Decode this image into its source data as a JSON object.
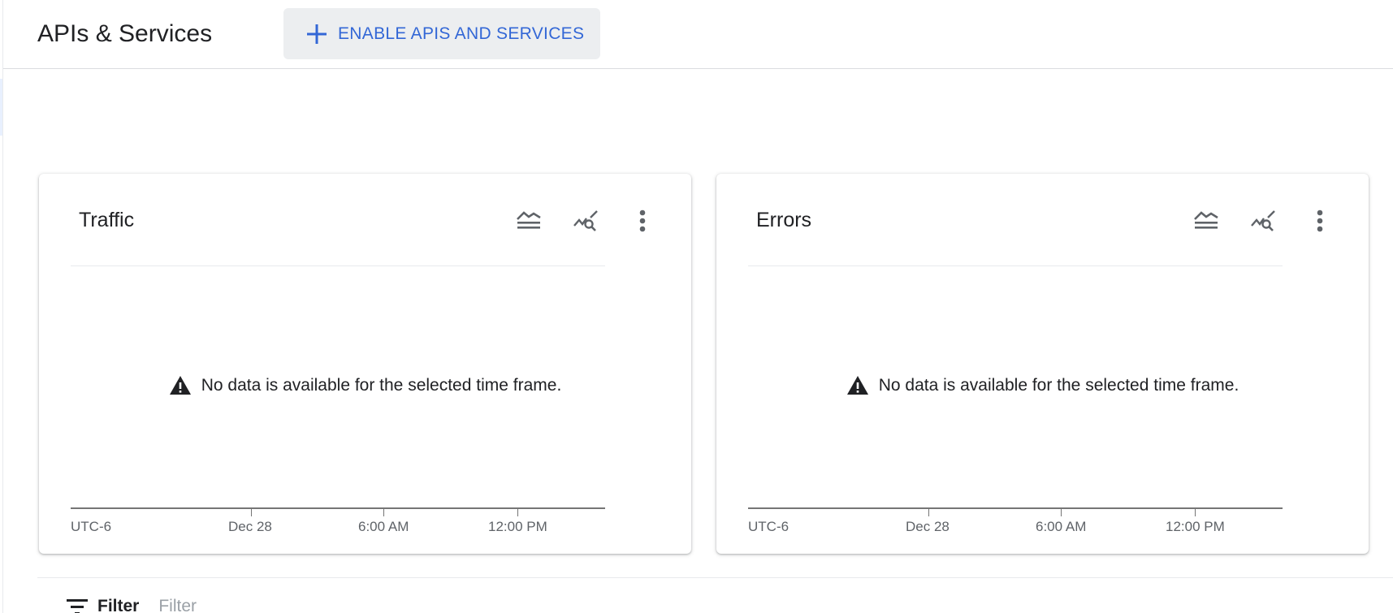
{
  "header": {
    "title": "APIs & Services",
    "enable_button_label": "ENABLE APIS AND SERVICES",
    "enable_button_icon": "plus-icon"
  },
  "cards": [
    {
      "title": "Traffic",
      "empty_message": "No data is available for the selected time frame.",
      "timezone": "UTC-6",
      "ticks": [
        "Dec 28",
        "6:00 AM",
        "12:00 PM"
      ]
    },
    {
      "title": "Errors",
      "empty_message": "No data is available for the selected time frame.",
      "timezone": "UTC-6",
      "ticks": [
        "Dec 28",
        "6:00 AM",
        "12:00 PM"
      ]
    }
  ],
  "filter": {
    "label": "Filter",
    "placeholder": "Filter"
  },
  "colors": {
    "accent": "#3367d6",
    "button_bg": "#eceef0",
    "axis": "#757575",
    "warning_icon": "#202124"
  }
}
